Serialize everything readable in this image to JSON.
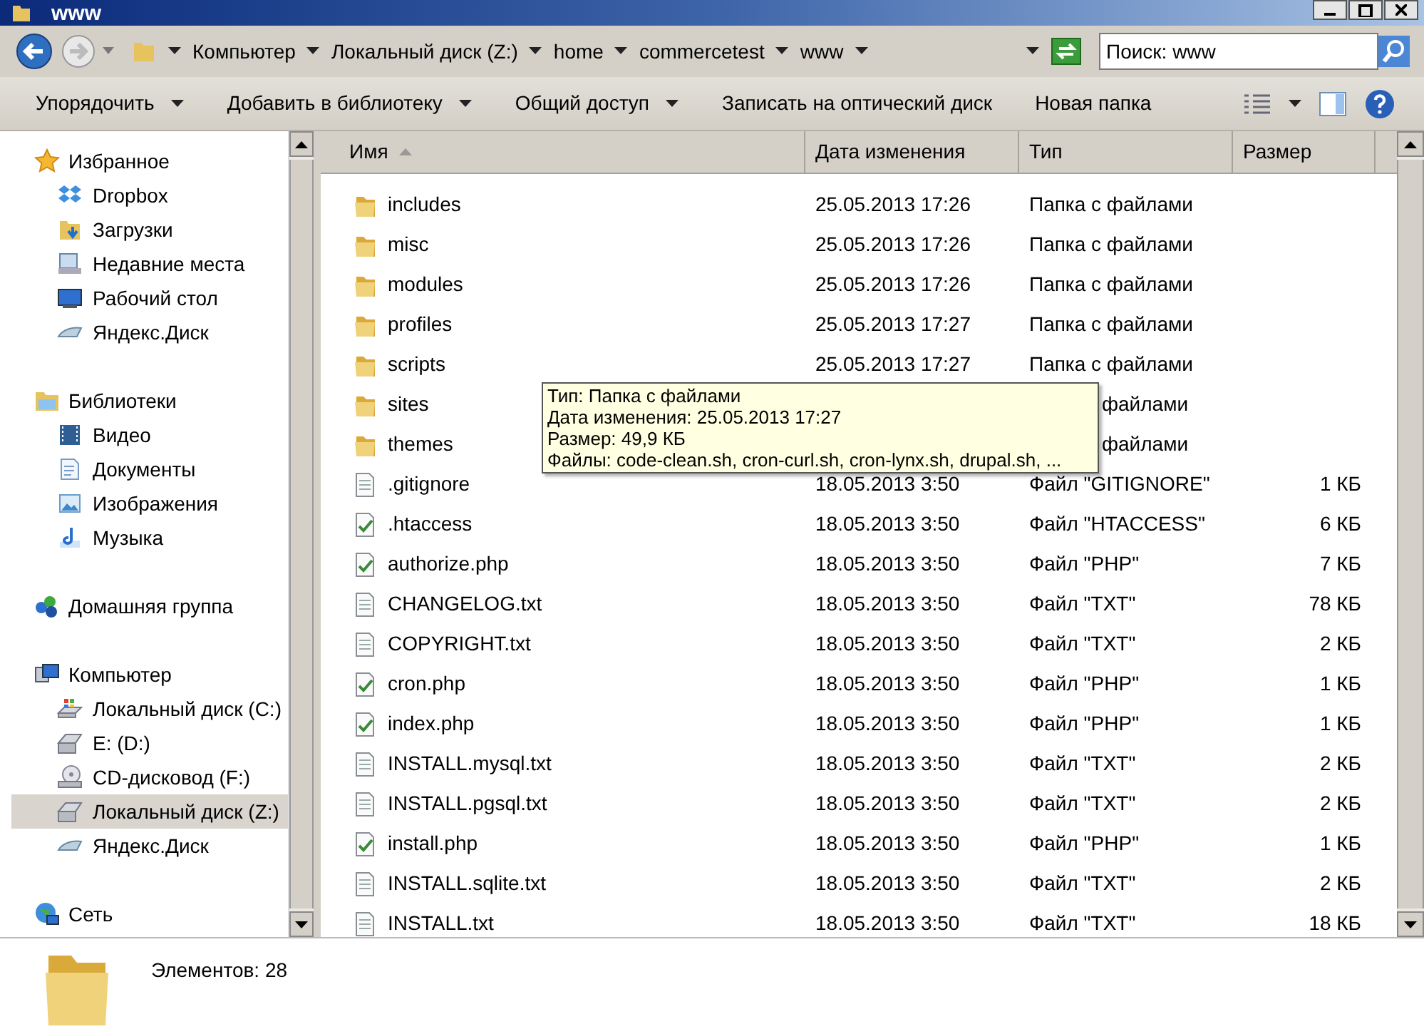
{
  "window": {
    "title": "www"
  },
  "address": {
    "crumbs": [
      "Компьютер",
      "Локальный диск (Z:)",
      "home",
      "commercetest",
      "www"
    ]
  },
  "search": {
    "placeholder": "Поиск: www"
  },
  "toolbar": {
    "buttons": [
      {
        "label": "Упорядочить",
        "dropdown": true
      },
      {
        "label": "Добавить в библиотеку",
        "dropdown": true
      },
      {
        "label": "Общий доступ",
        "dropdown": true
      },
      {
        "label": "Записать на оптический диск",
        "dropdown": false
      },
      {
        "label": "Новая папка",
        "dropdown": false
      }
    ]
  },
  "sidebar": {
    "groups": [
      {
        "label": "Избранное",
        "kind": "star",
        "children": [
          {
            "label": "Dropbox",
            "kind": "dropbox",
            "selected": false
          },
          {
            "label": "Загрузки",
            "kind": "downloads",
            "selected": false
          },
          {
            "label": "Недавние места",
            "kind": "recent",
            "selected": false
          },
          {
            "label": "Рабочий стол",
            "kind": "desktop",
            "selected": false
          },
          {
            "label": "Яндекс.Диск",
            "kind": "cloud",
            "selected": false
          }
        ]
      },
      {
        "label": "Библиотеки",
        "kind": "library",
        "children": [
          {
            "label": "Видео",
            "kind": "video",
            "selected": false
          },
          {
            "label": "Документы",
            "kind": "docs",
            "selected": false
          },
          {
            "label": "Изображения",
            "kind": "images",
            "selected": false
          },
          {
            "label": "Музыка",
            "kind": "music",
            "selected": false
          }
        ]
      },
      {
        "label": "Домашняя группа",
        "kind": "homegroup"
      },
      {
        "label": "Компьютер",
        "kind": "computer",
        "children": [
          {
            "label": "Локальный диск (C:)",
            "kind": "sysdrive",
            "selected": false
          },
          {
            "label": "E: (D:)",
            "kind": "drive",
            "selected": false
          },
          {
            "label": "CD-дисковод (F:)",
            "kind": "cd",
            "selected": false
          },
          {
            "label": "Локальный диск (Z:)",
            "kind": "drive",
            "selected": true
          },
          {
            "label": "Яндекс.Диск",
            "kind": "cloud",
            "selected": false
          }
        ]
      },
      {
        "label": "Сеть",
        "kind": "network"
      }
    ]
  },
  "table": {
    "columns": [
      {
        "label": "Имя",
        "sorted": true
      },
      {
        "label": "Дата изменения",
        "sorted": false
      },
      {
        "label": "Тип",
        "sorted": false
      },
      {
        "label": "Размер",
        "sorted": false
      }
    ],
    "rows": [
      {
        "kind": "folder",
        "name": "includes",
        "date": "25.05.2013 17:26",
        "type": "Папка с файлами"
      },
      {
        "kind": "folder",
        "name": "misc",
        "date": "25.05.2013 17:26",
        "type": "Папка с файлами"
      },
      {
        "kind": "folder",
        "name": "modules",
        "date": "25.05.2013 17:26",
        "type": "Папка с файлами"
      },
      {
        "kind": "folder",
        "name": "profiles",
        "date": "25.05.2013 17:27",
        "type": "Папка с файлами"
      },
      {
        "kind": "folder",
        "name": "scripts",
        "date": "25.05.2013 17:27",
        "type": "Папка с файлами"
      },
      {
        "kind": "folder",
        "name": "sites",
        "type": "файлами",
        "covered": true
      },
      {
        "kind": "folder",
        "name": "themes",
        "type": "файлами",
        "covered": true
      },
      {
        "kind": "text",
        "name": ".gitignore",
        "date": "18.05.2013 3:50",
        "type": "Файл \"GITIGNORE\"",
        "size": "1 КБ"
      },
      {
        "kind": "script",
        "name": ".htaccess",
        "date": "18.05.2013 3:50",
        "type": "Файл \"HTACCESS\"",
        "size": "6 КБ"
      },
      {
        "kind": "script",
        "name": "authorize.php",
        "date": "18.05.2013 3:50",
        "type": "Файл \"PHP\"",
        "size": "7 КБ"
      },
      {
        "kind": "text",
        "name": "CHANGELOG.txt",
        "date": "18.05.2013 3:50",
        "type": "Файл \"TXT\"",
        "size": "78 КБ"
      },
      {
        "kind": "text",
        "name": "COPYRIGHT.txt",
        "date": "18.05.2013 3:50",
        "type": "Файл \"TXT\"",
        "size": "2 КБ"
      },
      {
        "kind": "script",
        "name": "cron.php",
        "date": "18.05.2013 3:50",
        "type": "Файл \"PHP\"",
        "size": "1 КБ"
      },
      {
        "kind": "script",
        "name": "index.php",
        "date": "18.05.2013 3:50",
        "type": "Файл \"PHP\"",
        "size": "1 КБ"
      },
      {
        "kind": "text",
        "name": "INSTALL.mysql.txt",
        "date": "18.05.2013 3:50",
        "type": "Файл \"TXT\"",
        "size": "2 КБ"
      },
      {
        "kind": "text",
        "name": "INSTALL.pgsql.txt",
        "date": "18.05.2013 3:50",
        "type": "Файл \"TXT\"",
        "size": "2 КБ"
      },
      {
        "kind": "script",
        "name": "install.php",
        "date": "18.05.2013 3:50",
        "type": "Файл \"PHP\"",
        "size": "1 КБ"
      },
      {
        "kind": "text",
        "name": "INSTALL.sqlite.txt",
        "date": "18.05.2013 3:50",
        "type": "Файл \"TXT\"",
        "size": "2 КБ"
      },
      {
        "kind": "text",
        "name": "INSTALL.txt",
        "date": "18.05.2013 3:50",
        "type": "Файл \"TXT\"",
        "size": "18 КБ"
      }
    ]
  },
  "tooltip": {
    "lines": [
      "Тип: Папка с файлами",
      "Дата изменения: 25.05.2013 17:27",
      "Размер: 49,9 КБ",
      "Файлы: code-clean.sh, cron-curl.sh, cron-lynx.sh, drupal.sh, ..."
    ]
  },
  "status_bar": {
    "count": "Элементов: 28"
  }
}
